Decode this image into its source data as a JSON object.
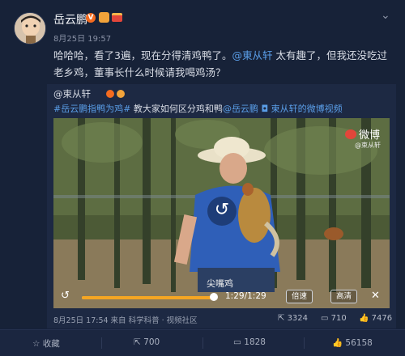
{
  "post": {
    "author": "岳云鹏",
    "verified_label": "V",
    "meta": "8月25日 19:57",
    "text_before": "哈哈哈，看了3遍，现在分得清鸡鸭了。",
    "mention": "@東从轩",
    "text_after": " 太有趣了，但我还没吃过老乡鸡，董事长什么时候请我喝鸡汤？",
    "chevron": "⌄"
  },
  "repost": {
    "author": "@束从轩",
    "hashtag1": "#岳云鹏指鸭为鸡#",
    "text": " 教大家如何区分鸡和鸭",
    "mention": "@岳云鹏",
    "video_link": "◘ 束从轩的微博视频",
    "video": {
      "watermark": "微博",
      "watermark_handle": "@束从轩",
      "subtitle": "尖嘴鸡",
      "time": "1:29/1:29",
      "speed_label": "倍速",
      "quality_label": "高清",
      "progress": 1.0
    },
    "footer": "8月25日 17:54 来自 科学科普 · 视频社区",
    "stats": {
      "reposts": "3324",
      "comments": "710",
      "likes": "7476"
    }
  },
  "actions": {
    "favorite": "收藏",
    "repost": "700",
    "comment": "1828",
    "like": "56158"
  }
}
